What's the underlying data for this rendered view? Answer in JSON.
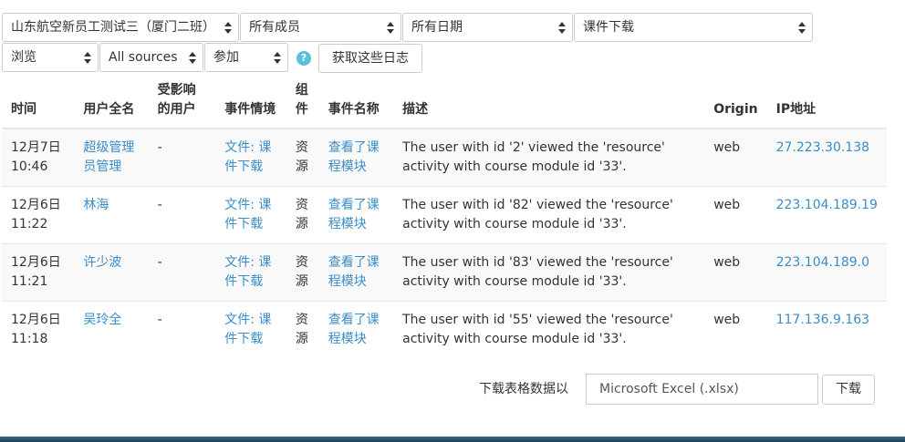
{
  "filters": {
    "course": "山东航空新员工测试三（厦门二班）",
    "members": "所有成员",
    "dates": "所有日期",
    "activity": "课件下载",
    "action": "浏览",
    "sources": "All sources",
    "edu_level": "参加",
    "help_symbol": "?",
    "submit_label": "获取这些日志"
  },
  "table": {
    "headers": {
      "time": "时间",
      "user": "用户全名",
      "affected": "受影响的用户",
      "context": "事件情境",
      "component": "组件",
      "event": "事件名称",
      "description": "描述",
      "origin": "Origin",
      "ip": "IP地址"
    },
    "rows": [
      {
        "time": "12月7日 10:46",
        "user": "超级管理员管理",
        "affected": "-",
        "context": "文件: 课件下载",
        "component": "资源",
        "event": "查看了课程模块",
        "description": "The user with id '2' viewed the 'resource' activity with course module id '33'.",
        "origin": "web",
        "ip": "27.223.30.138"
      },
      {
        "time": "12月6日 11:22",
        "user": "林海",
        "affected": "-",
        "context": "文件: 课件下载",
        "component": "资源",
        "event": "查看了课程模块",
        "description": "The user with id '82' viewed the 'resource' activity with course module id '33'.",
        "origin": "web",
        "ip": "223.104.189.19"
      },
      {
        "time": "12月6日 11:21",
        "user": "许少波",
        "affected": "-",
        "context": "文件: 课件下载",
        "component": "资源",
        "event": "查看了课程模块",
        "description": "The user with id '83' viewed the 'resource' activity with course module id '33'.",
        "origin": "web",
        "ip": "223.104.189.0"
      },
      {
        "time": "12月6日 11:18",
        "user": "吴玲全",
        "affected": "-",
        "context": "文件: 课件下载",
        "component": "资源",
        "event": "查看了课程模块",
        "description": "The user with id '55' viewed the 'resource' activity with course module id '33'.",
        "origin": "web",
        "ip": "117.136.9.163"
      }
    ]
  },
  "download": {
    "label": "下载表格数据以",
    "format": "Microsoft Excel (.xlsx)",
    "button": "下载"
  }
}
